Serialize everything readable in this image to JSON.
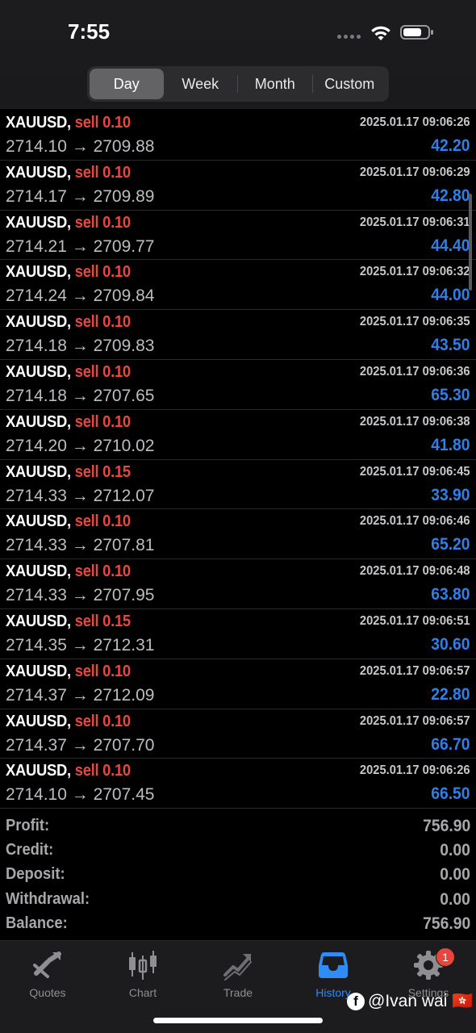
{
  "status_bar": {
    "time": "7:55"
  },
  "period_tabs": [
    {
      "label": "Day",
      "active": true
    },
    {
      "label": "Week",
      "active": false
    },
    {
      "label": "Month",
      "active": false
    },
    {
      "label": "Custom",
      "active": false
    }
  ],
  "trades": [
    {
      "symbol": "XAUUSD,",
      "side": "sell 0.10",
      "time": "2025.01.17 09:06:26",
      "prices": "2714.10 → 2709.88",
      "profit": "42.20"
    },
    {
      "symbol": "XAUUSD,",
      "side": "sell 0.10",
      "time": "2025.01.17 09:06:29",
      "prices": "2714.17 → 2709.89",
      "profit": "42.80"
    },
    {
      "symbol": "XAUUSD,",
      "side": "sell 0.10",
      "time": "2025.01.17 09:06:31",
      "prices": "2714.21 → 2709.77",
      "profit": "44.40"
    },
    {
      "symbol": "XAUUSD,",
      "side": "sell 0.10",
      "time": "2025.01.17 09:06:32",
      "prices": "2714.24 → 2709.84",
      "profit": "44.00"
    },
    {
      "symbol": "XAUUSD,",
      "side": "sell 0.10",
      "time": "2025.01.17 09:06:35",
      "prices": "2714.18 → 2709.83",
      "profit": "43.50"
    },
    {
      "symbol": "XAUUSD,",
      "side": "sell 0.10",
      "time": "2025.01.17 09:06:36",
      "prices": "2714.18 → 2707.65",
      "profit": "65.30"
    },
    {
      "symbol": "XAUUSD,",
      "side": "sell 0.10",
      "time": "2025.01.17 09:06:38",
      "prices": "2714.20 → 2710.02",
      "profit": "41.80"
    },
    {
      "symbol": "XAUUSD,",
      "side": "sell 0.15",
      "time": "2025.01.17 09:06:45",
      "prices": "2714.33 → 2712.07",
      "profit": "33.90"
    },
    {
      "symbol": "XAUUSD,",
      "side": "sell 0.10",
      "time": "2025.01.17 09:06:46",
      "prices": "2714.33 → 2707.81",
      "profit": "65.20"
    },
    {
      "symbol": "XAUUSD,",
      "side": "sell 0.10",
      "time": "2025.01.17 09:06:48",
      "prices": "2714.33 → 2707.95",
      "profit": "63.80"
    },
    {
      "symbol": "XAUUSD,",
      "side": "sell 0.15",
      "time": "2025.01.17 09:06:51",
      "prices": "2714.35 → 2712.31",
      "profit": "30.60"
    },
    {
      "symbol": "XAUUSD,",
      "side": "sell 0.10",
      "time": "2025.01.17 09:06:57",
      "prices": "2714.37 → 2712.09",
      "profit": "22.80"
    },
    {
      "symbol": "XAUUSD,",
      "side": "sell 0.10",
      "time": "2025.01.17 09:06:57",
      "prices": "2714.37 → 2707.70",
      "profit": "66.70"
    },
    {
      "symbol": "XAUUSD,",
      "side": "sell 0.10",
      "time": "2025.01.17 09:06:26",
      "prices": "2714.10 → 2707.45",
      "profit": "66.50"
    }
  ],
  "summary": [
    {
      "label": "Profit:",
      "value": "756.90"
    },
    {
      "label": "Credit:",
      "value": "0.00"
    },
    {
      "label": "Deposit:",
      "value": "0.00"
    },
    {
      "label": "Withdrawal:",
      "value": "0.00"
    },
    {
      "label": "Balance:",
      "value": "756.90"
    }
  ],
  "tab_bar": {
    "quotes": "Quotes",
    "chart": "Chart",
    "trade": "Trade",
    "history": "History",
    "settings": "Settings",
    "settings_badge": "1"
  },
  "watermark": {
    "text": "@Ivan wai 🇭🇰"
  },
  "colors": {
    "sell": "#e5483f",
    "profit": "#2f7fe6",
    "active_tab": "#2f8cf5"
  }
}
